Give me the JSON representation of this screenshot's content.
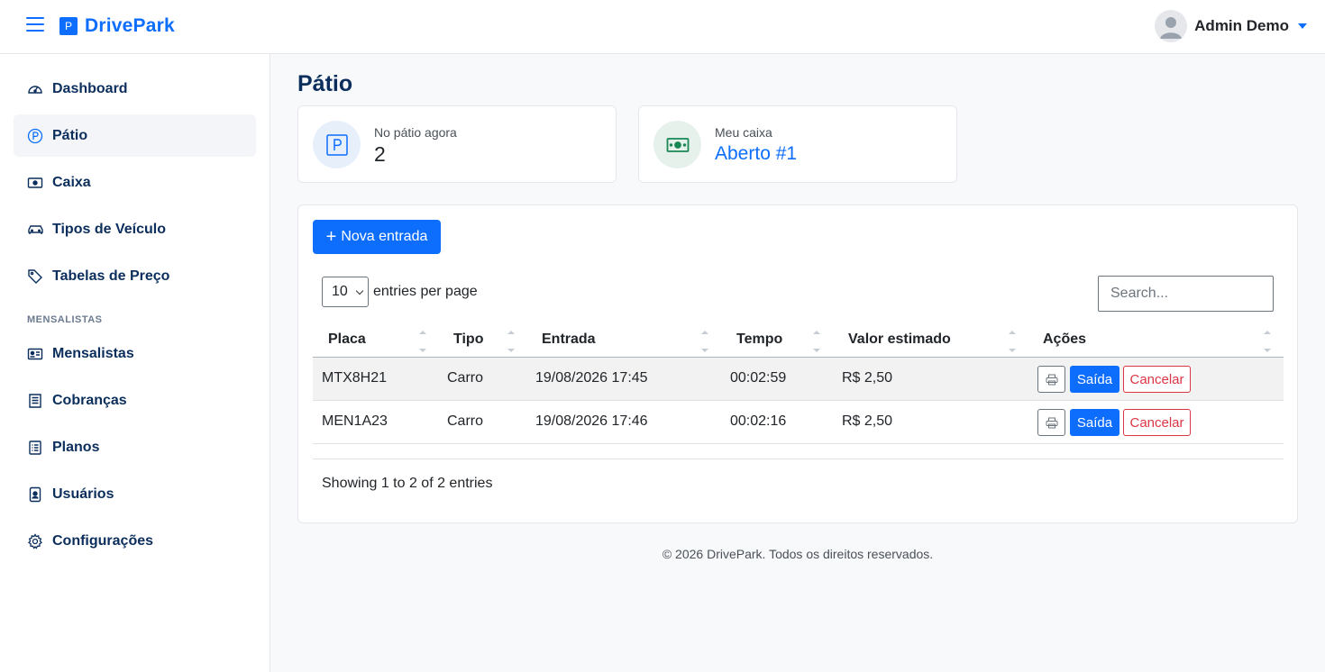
{
  "app": {
    "brand_badge": "P",
    "brand_name": "DrivePark"
  },
  "user": {
    "name": "Admin Demo"
  },
  "sidebar": {
    "items": [
      {
        "label": "Dashboard",
        "icon": "speedometer-icon"
      },
      {
        "label": "Pátio",
        "icon": "parking-circle-icon",
        "active": true
      },
      {
        "label": "Caixa",
        "icon": "cash-icon"
      },
      {
        "label": "Tipos de Veículo",
        "icon": "car-icon"
      },
      {
        "label": "Tabelas de Preço",
        "icon": "tag-icon"
      }
    ],
    "section": "MENSALISTAS",
    "section_items": [
      {
        "label": "Mensalistas",
        "icon": "id-card-icon"
      },
      {
        "label": "Cobranças",
        "icon": "receipt-icon"
      },
      {
        "label": "Planos",
        "icon": "list-doc-icon"
      },
      {
        "label": "Usuários",
        "icon": "user-badge-icon"
      },
      {
        "label": "Configurações",
        "icon": "gear-icon"
      }
    ]
  },
  "page": {
    "title": "Pátio"
  },
  "stats": {
    "patio": {
      "label": "No pátio agora",
      "value": "2"
    },
    "caixa": {
      "label": "Meu caixa",
      "value": "Aberto #1"
    }
  },
  "panel": {
    "new_button": "Nova entrada",
    "per_page_value": "10",
    "per_page_label": "entries per page",
    "search_placeholder": "Search...",
    "columns": [
      "Placa",
      "Tipo",
      "Entrada",
      "Tempo",
      "Valor estimado",
      "Ações"
    ],
    "rows": [
      {
        "placa": "MTX8H21",
        "tipo": "Carro",
        "entrada": "19/08/2026 17:45",
        "tempo": "00:02:59",
        "valor": "R$ 2,50"
      },
      {
        "placa": "MEN1A23",
        "tipo": "Carro",
        "entrada": "19/08/2026 17:46",
        "tempo": "00:02:16",
        "valor": "R$ 2,50"
      }
    ],
    "actions": {
      "saida": "Saída",
      "cancelar": "Cancelar"
    },
    "info": "Showing 1 to 2 of 2 entries"
  },
  "footer": "© 2026 DrivePark. Todos os direitos reservados.",
  "colors": {
    "primary": "#0d6efd",
    "danger": "#dc3545",
    "navy": "#0b2e5c",
    "success": "#198754"
  }
}
